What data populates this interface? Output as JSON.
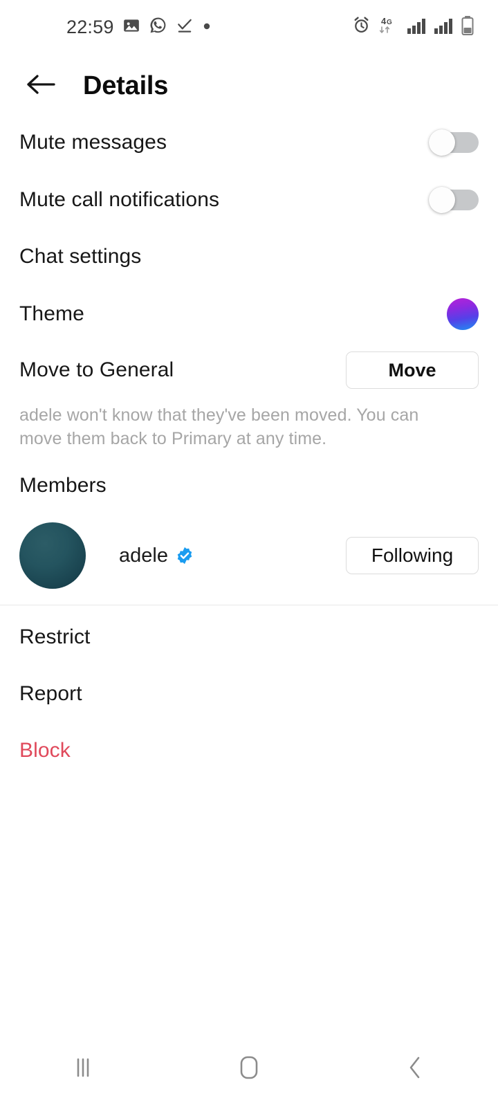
{
  "status_bar": {
    "time": "22:59",
    "left_icons": [
      "gallery-icon",
      "whatsapp-icon",
      "checkmark-underline-icon",
      "dot-icon"
    ],
    "right_icons": [
      "alarm-icon",
      "network-4g-icon",
      "signal-bars-icon",
      "signal-bars-icon",
      "battery-icon"
    ],
    "network_label": "4G",
    "battery_level_percent": 40
  },
  "header": {
    "title": "Details",
    "back_icon": "arrow-left-icon"
  },
  "settings": {
    "mute_messages": {
      "label": "Mute messages",
      "enabled": false
    },
    "mute_call_notifications": {
      "label": "Mute call notifications",
      "enabled": false
    },
    "chat_settings_heading": "Chat settings",
    "theme": {
      "label": "Theme",
      "swatch_colors": [
        "#b622d8",
        "#1f8ef1"
      ]
    },
    "move_to_general": {
      "label": "Move to General",
      "button_label": "Move",
      "helper_text": "adele won't know that they've been moved. You can move them back to Primary at any time."
    }
  },
  "members": {
    "heading": "Members",
    "list": [
      {
        "name": "adele",
        "verified": true,
        "action_label": "Following",
        "avatar_color": "#1d4c58"
      }
    ]
  },
  "actions": [
    {
      "label": "Restrict",
      "style": "normal"
    },
    {
      "label": "Report",
      "style": "normal"
    },
    {
      "label": "Block",
      "style": "danger"
    }
  ],
  "colors": {
    "danger": "#e0495b",
    "verified_badge": "#1a9cf0",
    "toggle_track_off": "#c6c8ca",
    "divider": "#e9e9e9",
    "helper_text": "#a6a6a6"
  },
  "nav_bar": {
    "recents_icon": "recents-icon",
    "home_icon": "home-icon",
    "back_icon": "chevron-left-icon"
  }
}
